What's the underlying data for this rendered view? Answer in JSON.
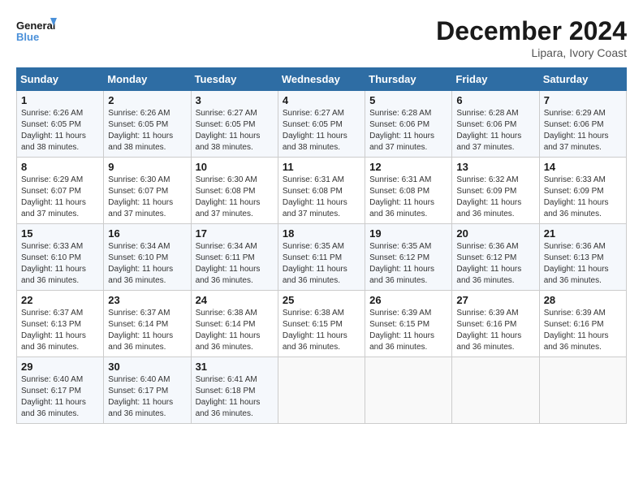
{
  "header": {
    "logo_line1": "General",
    "logo_line2": "Blue",
    "month": "December 2024",
    "location": "Lipara, Ivory Coast"
  },
  "weekdays": [
    "Sunday",
    "Monday",
    "Tuesday",
    "Wednesday",
    "Thursday",
    "Friday",
    "Saturday"
  ],
  "weeks": [
    [
      {
        "day": "1",
        "sunrise": "6:26 AM",
        "sunset": "6:05 PM",
        "daylight": "11 hours and 38 minutes."
      },
      {
        "day": "2",
        "sunrise": "6:26 AM",
        "sunset": "6:05 PM",
        "daylight": "11 hours and 38 minutes."
      },
      {
        "day": "3",
        "sunrise": "6:27 AM",
        "sunset": "6:05 PM",
        "daylight": "11 hours and 38 minutes."
      },
      {
        "day": "4",
        "sunrise": "6:27 AM",
        "sunset": "6:05 PM",
        "daylight": "11 hours and 38 minutes."
      },
      {
        "day": "5",
        "sunrise": "6:28 AM",
        "sunset": "6:06 PM",
        "daylight": "11 hours and 37 minutes."
      },
      {
        "day": "6",
        "sunrise": "6:28 AM",
        "sunset": "6:06 PM",
        "daylight": "11 hours and 37 minutes."
      },
      {
        "day": "7",
        "sunrise": "6:29 AM",
        "sunset": "6:06 PM",
        "daylight": "11 hours and 37 minutes."
      }
    ],
    [
      {
        "day": "8",
        "sunrise": "6:29 AM",
        "sunset": "6:07 PM",
        "daylight": "11 hours and 37 minutes."
      },
      {
        "day": "9",
        "sunrise": "6:30 AM",
        "sunset": "6:07 PM",
        "daylight": "11 hours and 37 minutes."
      },
      {
        "day": "10",
        "sunrise": "6:30 AM",
        "sunset": "6:08 PM",
        "daylight": "11 hours and 37 minutes."
      },
      {
        "day": "11",
        "sunrise": "6:31 AM",
        "sunset": "6:08 PM",
        "daylight": "11 hours and 37 minutes."
      },
      {
        "day": "12",
        "sunrise": "6:31 AM",
        "sunset": "6:08 PM",
        "daylight": "11 hours and 36 minutes."
      },
      {
        "day": "13",
        "sunrise": "6:32 AM",
        "sunset": "6:09 PM",
        "daylight": "11 hours and 36 minutes."
      },
      {
        "day": "14",
        "sunrise": "6:33 AM",
        "sunset": "6:09 PM",
        "daylight": "11 hours and 36 minutes."
      }
    ],
    [
      {
        "day": "15",
        "sunrise": "6:33 AM",
        "sunset": "6:10 PM",
        "daylight": "11 hours and 36 minutes."
      },
      {
        "day": "16",
        "sunrise": "6:34 AM",
        "sunset": "6:10 PM",
        "daylight": "11 hours and 36 minutes."
      },
      {
        "day": "17",
        "sunrise": "6:34 AM",
        "sunset": "6:11 PM",
        "daylight": "11 hours and 36 minutes."
      },
      {
        "day": "18",
        "sunrise": "6:35 AM",
        "sunset": "6:11 PM",
        "daylight": "11 hours and 36 minutes."
      },
      {
        "day": "19",
        "sunrise": "6:35 AM",
        "sunset": "6:12 PM",
        "daylight": "11 hours and 36 minutes."
      },
      {
        "day": "20",
        "sunrise": "6:36 AM",
        "sunset": "6:12 PM",
        "daylight": "11 hours and 36 minutes."
      },
      {
        "day": "21",
        "sunrise": "6:36 AM",
        "sunset": "6:13 PM",
        "daylight": "11 hours and 36 minutes."
      }
    ],
    [
      {
        "day": "22",
        "sunrise": "6:37 AM",
        "sunset": "6:13 PM",
        "daylight": "11 hours and 36 minutes."
      },
      {
        "day": "23",
        "sunrise": "6:37 AM",
        "sunset": "6:14 PM",
        "daylight": "11 hours and 36 minutes."
      },
      {
        "day": "24",
        "sunrise": "6:38 AM",
        "sunset": "6:14 PM",
        "daylight": "11 hours and 36 minutes."
      },
      {
        "day": "25",
        "sunrise": "6:38 AM",
        "sunset": "6:15 PM",
        "daylight": "11 hours and 36 minutes."
      },
      {
        "day": "26",
        "sunrise": "6:39 AM",
        "sunset": "6:15 PM",
        "daylight": "11 hours and 36 minutes."
      },
      {
        "day": "27",
        "sunrise": "6:39 AM",
        "sunset": "6:16 PM",
        "daylight": "11 hours and 36 minutes."
      },
      {
        "day": "28",
        "sunrise": "6:39 AM",
        "sunset": "6:16 PM",
        "daylight": "11 hours and 36 minutes."
      }
    ],
    [
      {
        "day": "29",
        "sunrise": "6:40 AM",
        "sunset": "6:17 PM",
        "daylight": "11 hours and 36 minutes."
      },
      {
        "day": "30",
        "sunrise": "6:40 AM",
        "sunset": "6:17 PM",
        "daylight": "11 hours and 36 minutes."
      },
      {
        "day": "31",
        "sunrise": "6:41 AM",
        "sunset": "6:18 PM",
        "daylight": "11 hours and 36 minutes."
      },
      null,
      null,
      null,
      null
    ]
  ]
}
